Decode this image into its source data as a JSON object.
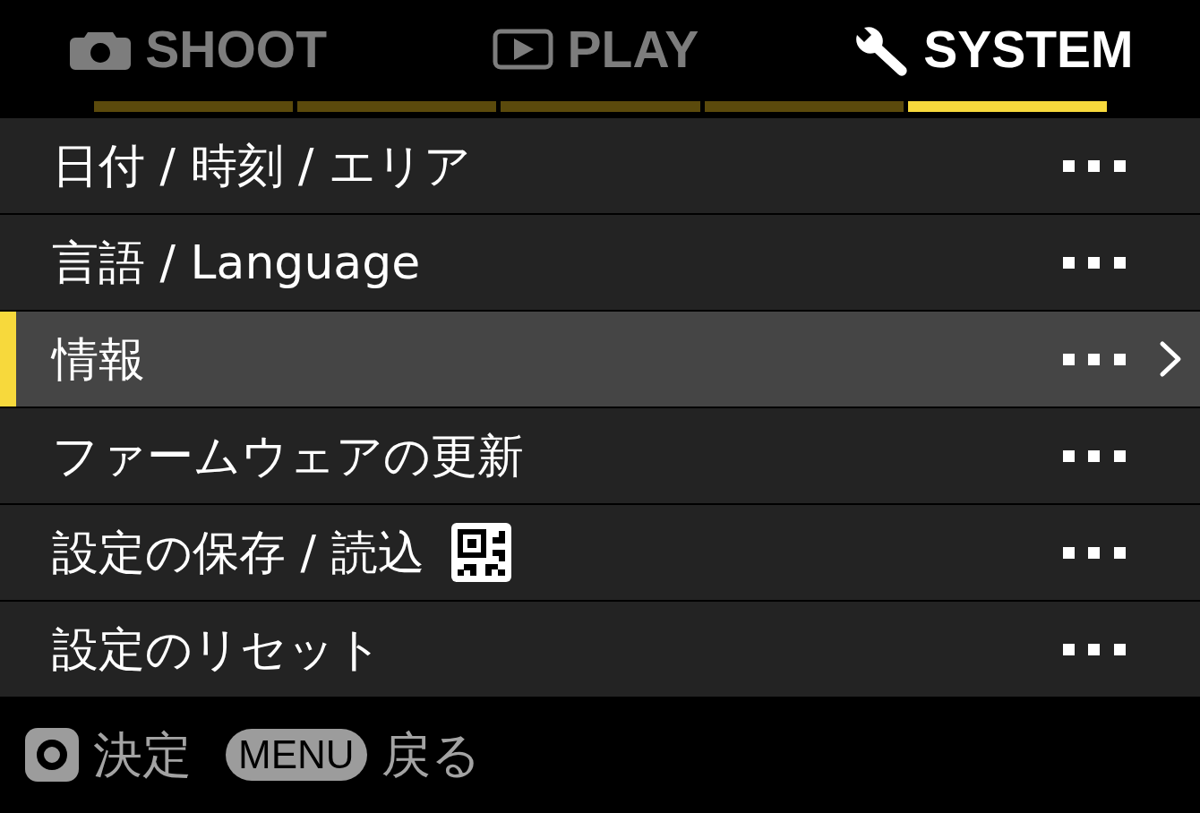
{
  "tabs": [
    {
      "label": "SHOOT",
      "selected": false
    },
    {
      "label": "PLAY",
      "selected": false
    },
    {
      "label": "SYSTEM",
      "selected": true
    }
  ],
  "page_indicator": [
    {
      "selected": false
    },
    {
      "selected": false
    },
    {
      "selected": false
    },
    {
      "selected": false
    },
    {
      "selected": true
    }
  ],
  "menu_items": [
    {
      "label": "日付 / 時刻 / エリア",
      "kind": "plain",
      "selected": false
    },
    {
      "label": "言語 / Language",
      "kind": "plain",
      "selected": false
    },
    {
      "label": "情報",
      "kind": "plain",
      "selected": true
    },
    {
      "label": "ファームウェアの更新",
      "kind": "plain",
      "selected": false
    },
    {
      "label": "設定の保存 / 読込",
      "kind": "with-code",
      "selected": false
    },
    {
      "label": "設定のリセット",
      "kind": "plain",
      "selected": false
    }
  ],
  "footer_hints": [
    {
      "kind": "round-key",
      "label": "決定"
    },
    {
      "kind": "text-key",
      "key": "MENU",
      "label": "戻る"
    }
  ]
}
